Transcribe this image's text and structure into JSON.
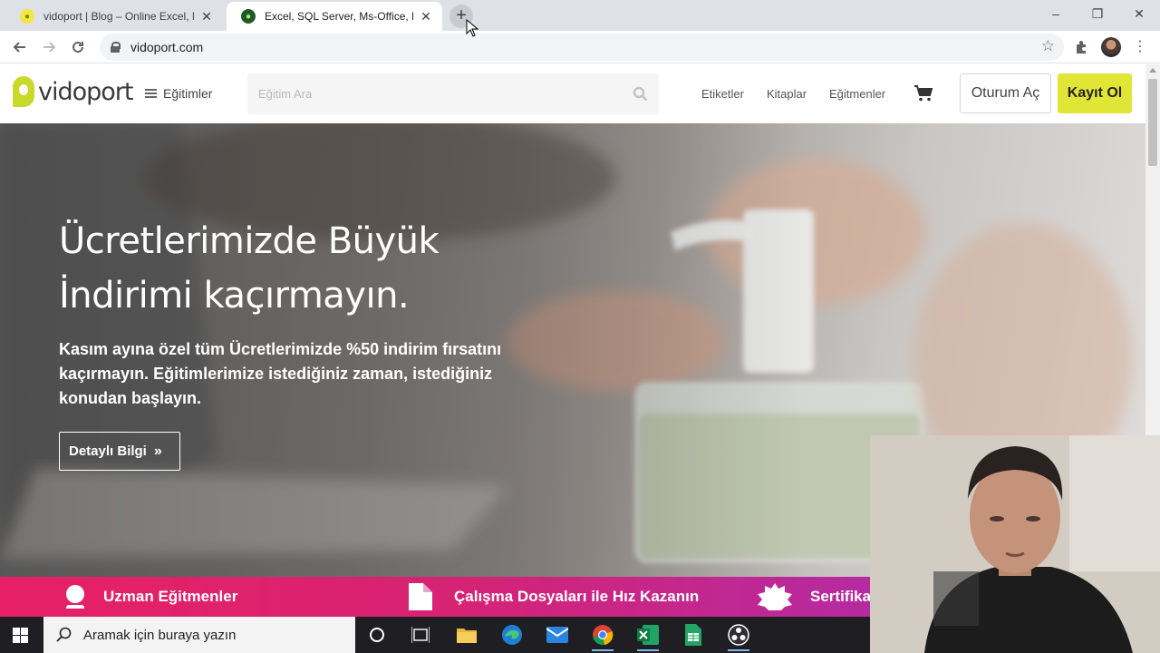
{
  "browser": {
    "tabs": [
      {
        "title": "vidoport | Blog – Online Excel, M",
        "favicon": "vidoport-favicon",
        "active": false
      },
      {
        "title": "Excel, SQL Server, Ms-Office, Libr",
        "favicon": "vidoport-green-favicon",
        "active": true
      }
    ],
    "new_tab_label": "+",
    "address": "vidoport.com",
    "window_controls": {
      "minimize": "–",
      "restore": "❐",
      "close": "✕"
    },
    "icons": [
      "back-icon",
      "forward-icon",
      "reload-icon",
      "lock-icon",
      "bookmark-star-icon",
      "extensions-icon",
      "profile-avatar",
      "kebab-menu-icon"
    ]
  },
  "site": {
    "logo_text": "vidoport",
    "menu_label": "Eğitimler",
    "search_placeholder": "Eğitim Ara",
    "nav_links": [
      "Etiketler",
      "Kitaplar",
      "Eğitmenler"
    ],
    "login_label": "Oturum Aç",
    "signup_label": "Kayıt Ol",
    "accent_color": "#e0e536"
  },
  "hero": {
    "title": "Ücretlerimizde Büyük İndirimi kaçırmayın.",
    "subtitle": "Kasım ayına özel tüm Ücretlerimizde %50 indirim fırsatını kaçırmayın. Eğitimlerimize istediğiniz zaman, istediğiniz konudan başlayın.",
    "button_label": "Detaylı Bilgi",
    "button_icon": "double-chevron-right-icon"
  },
  "features": [
    {
      "label": "Uzman Eğitmenler",
      "icon": "user-icon"
    },
    {
      "label": "Çalışma Dosyaları ile Hız Kazanın",
      "icon": "file-icon"
    },
    {
      "label": "Sertifika",
      "icon": "badge-icon"
    }
  ],
  "taskbar": {
    "search_placeholder": "Aramak için buraya yazın",
    "apps": [
      "cortana-icon",
      "task-view-icon",
      "file-explorer-icon",
      "edge-icon",
      "mail-icon",
      "chrome-icon",
      "excel-icon",
      "sheets-icon",
      "obs-icon"
    ]
  }
}
